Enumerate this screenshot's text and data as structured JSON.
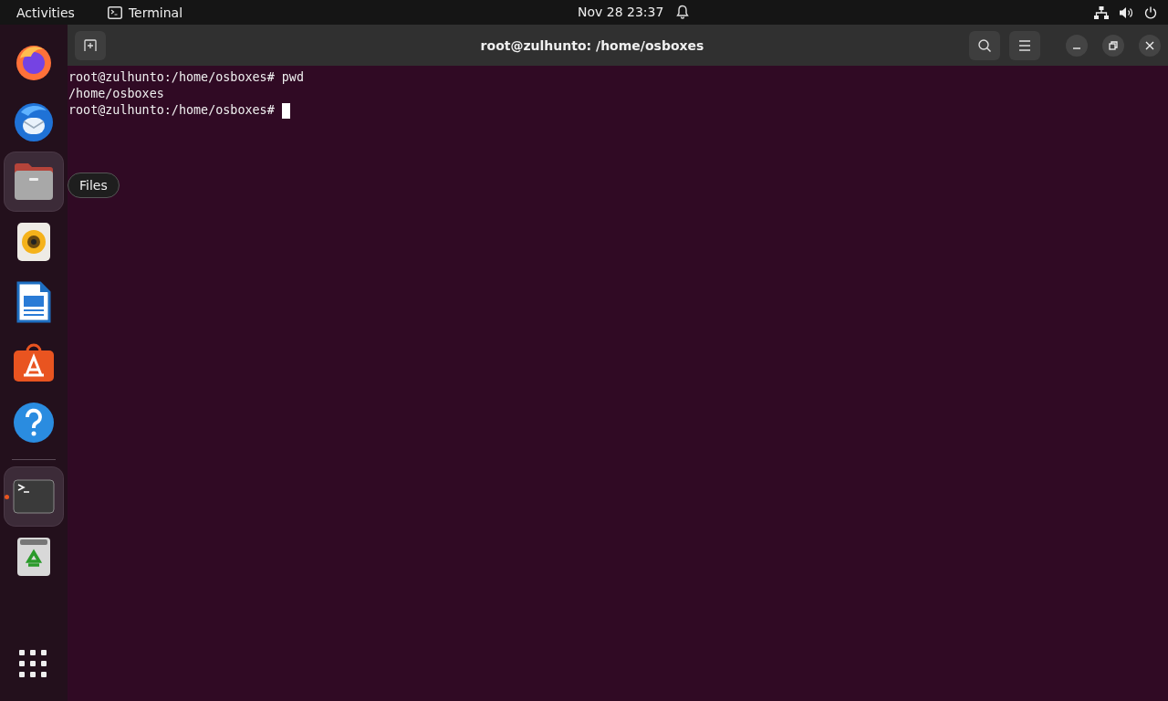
{
  "top_bar": {
    "activities": "Activities",
    "app_name": "Terminal",
    "clock": "Nov 28  23:37"
  },
  "dock": {
    "items": [
      {
        "kind": "firefox",
        "selected": false,
        "running": false
      },
      {
        "kind": "thunderbird",
        "selected": false,
        "running": false
      },
      {
        "kind": "files",
        "selected": true,
        "running": false
      },
      {
        "kind": "rhythmbox",
        "selected": false,
        "running": false
      },
      {
        "kind": "writer",
        "selected": false,
        "running": false
      },
      {
        "kind": "software",
        "selected": false,
        "running": false
      },
      {
        "kind": "help",
        "selected": false,
        "running": false
      }
    ],
    "after_separator": [
      {
        "kind": "terminal",
        "selected": true,
        "running": true
      },
      {
        "kind": "trash",
        "selected": false,
        "running": false
      }
    ],
    "tooltip": "Files"
  },
  "window": {
    "title": "root@zulhunto: /home/osboxes"
  },
  "terminal": {
    "lines": [
      {
        "text": "root@zulhunto:/home/osboxes# pwd",
        "cursor": false
      },
      {
        "text": "/home/osboxes",
        "cursor": false
      },
      {
        "text": "root@zulhunto:/home/osboxes# ",
        "cursor": true
      }
    ]
  }
}
